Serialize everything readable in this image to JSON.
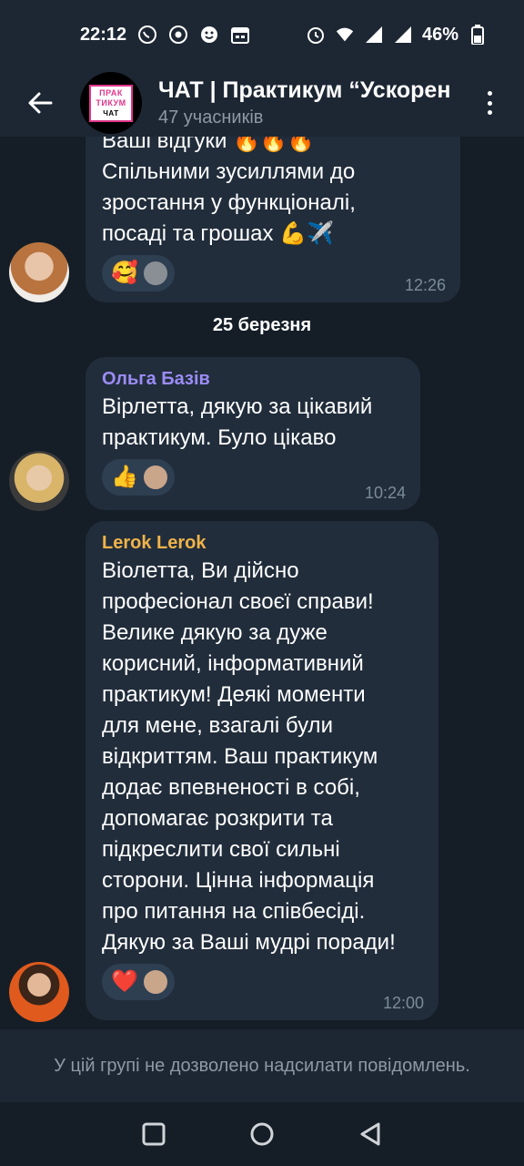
{
  "status": {
    "time": "22:12",
    "battery": "46%",
    "left_icons": [
      "viber-icon",
      "chrome-icon",
      "emoji-app-icon",
      "calendar-icon"
    ],
    "right_icons": [
      "alarm-icon",
      "wifi-icon",
      "signal-icon",
      "signal-icon-2",
      "battery-icon"
    ]
  },
  "header": {
    "title": "ЧАТ | Практикум “Ускорення",
    "subtitle": "47 учасників",
    "avatar_lines": [
      "ПРАК",
      "ТИКУМ",
      "ЧАТ"
    ]
  },
  "messages": [
    {
      "text_lines": [
        "Ваші відгуки 🔥🔥🔥",
        "Спільними зусиллями до",
        "зростання у функціоналі,",
        "посаді та грошах 💪✈️"
      ],
      "reactions": [
        "🥰"
      ],
      "time": "12:26"
    },
    {
      "sender": "Ольга Базів",
      "text_lines": [
        "Вірлетта, дякую за цікавий",
        "практикум. Було цікаво"
      ],
      "reactions": [
        "👍"
      ],
      "time": "10:24"
    },
    {
      "sender": "Lerok Lerok",
      "text_lines": [
        "Віолетта, Ви дійсно",
        "професіонал своєї справи!",
        "Велике дякую за дуже",
        "корисний, інформативний",
        "практикум! Деякі моменти",
        "для мене, взагалі були",
        "відкриттям. Ваш практикум",
        "додає впевненості в собі,",
        "допомагає розкрити та",
        "підкреслити свої сильні",
        "сторони. Цінна інформація",
        "про питання на співбесіді.",
        "Дякую за Ваші мудрі поради!"
      ],
      "reactions": [
        "❤️"
      ],
      "time": "12:00"
    }
  ],
  "date_separator": "25 березня",
  "bottom_notice": "У цій групі не дозволено надсилати повідомлень.",
  "colors": {
    "sender_1": "#9b8cf5",
    "sender_2": "#f0b34a",
    "bubble": "#212d3b",
    "background": "#151e27"
  }
}
